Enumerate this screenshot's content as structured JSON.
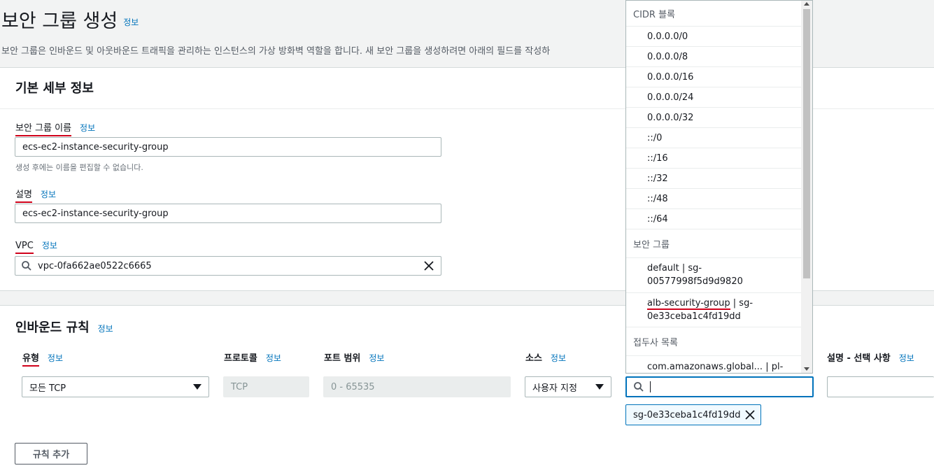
{
  "page": {
    "title": "보안 그룹 생성",
    "title_info": "정보",
    "description": "보안 그룹은 인바운드 및 아웃바운드 트래픽을 관리하는 인스턴스의 가상 방화벽 역할을 합니다. 새 보안 그룹을 생성하려면 아래의 필드를 작성하"
  },
  "basic": {
    "heading": "기본 세부 정보",
    "name_label": "보안 그룹 이름",
    "name_info": "정보",
    "name_value": "ecs-ec2-instance-security-group",
    "name_hint": "생성 후에는 이름을 편집할 수 없습니다.",
    "desc_label": "설명",
    "desc_info": "정보",
    "desc_value": "ecs-ec2-instance-security-group",
    "vpc_label": "VPC",
    "vpc_info": "정보",
    "vpc_value": "vpc-0fa662ae0522c6665"
  },
  "inbound": {
    "heading": "인바운드 규칙",
    "heading_info": "정보",
    "columns": [
      {
        "label": "유형",
        "info": "정보"
      },
      {
        "label": "프로토콜",
        "info": "정보"
      },
      {
        "label": "포트 범위",
        "info": "정보"
      },
      {
        "label": "소스",
        "info": "정보"
      },
      {
        "label": "설명 - 선택 사항",
        "info": "정보"
      }
    ],
    "type_value": "모든 TCP",
    "protocol_value": "TCP",
    "port_value": "0 - 65535",
    "source_value": "사용자 지정",
    "token_value": "sg-0e33ceba1c4fd19dd",
    "add_rule_label": "규칙 추가"
  },
  "dropdown": {
    "cidr_group": "CIDR 블록",
    "cidr_items": [
      "0.0.0.0/0",
      "0.0.0.0/8",
      "0.0.0.0/16",
      "0.0.0.0/24",
      "0.0.0.0/32",
      "::/0",
      "::/16",
      "::/32",
      "::/48",
      "::/64"
    ],
    "sg_group": "보안 그룹",
    "sg_default_line1": "default | sg-",
    "sg_default_line2": "00577998f5d9d9820",
    "sg_alb_name": "alb-security-group",
    "sg_alb_rest": " | sg-",
    "sg_alb_line2": "0e33ceba1c4fd19dd",
    "prefix_group": "접두사 목록",
    "prefix_item": "com.amazonaws.global... | pl-"
  },
  "colors": {
    "link": "#0073bb",
    "annotation_red": "#d0021b",
    "focus": "#0073bb"
  }
}
